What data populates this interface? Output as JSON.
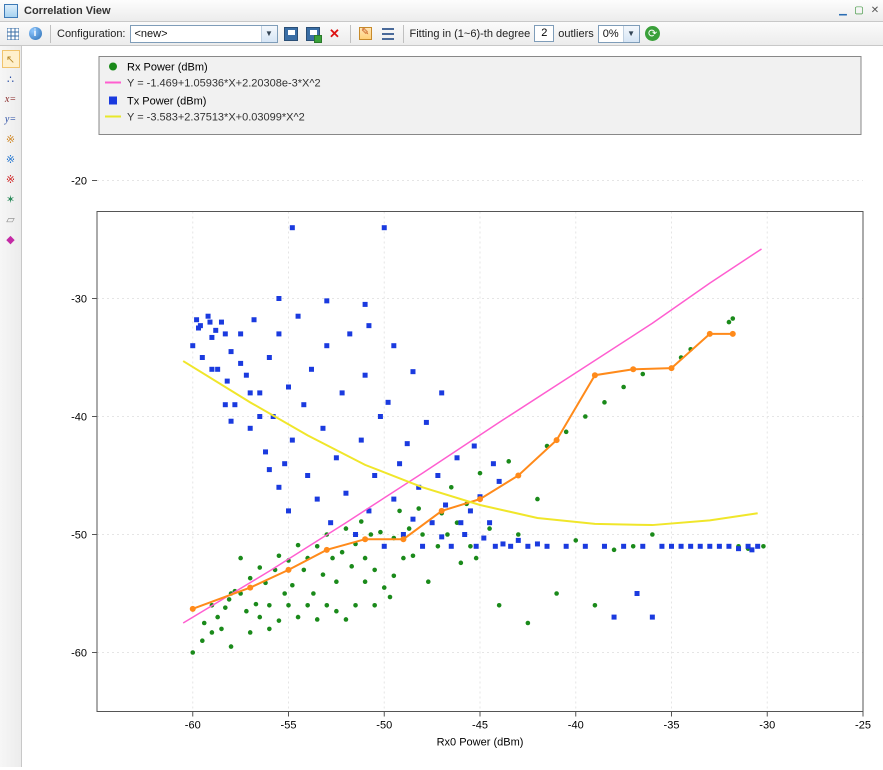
{
  "window": {
    "title": "Correlation View"
  },
  "toolbar": {
    "config_label": "Configuration:",
    "config_value": "<new>",
    "fitting_prefix": "Fitting in (1~6)-th degree",
    "fitting_degree": "2",
    "outliers_label": "outliers",
    "outliers_value": "0%"
  },
  "palette": {
    "items": [
      {
        "name": "select-arrow",
        "glyph": "↖",
        "cls": "arrow-sel",
        "active": true
      },
      {
        "name": "scatter-style",
        "glyph": "∴",
        "cls": "dots"
      },
      {
        "name": "x-equals",
        "glyph": "x=",
        "cls": "xeq"
      },
      {
        "name": "y-equals",
        "glyph": "y=",
        "cls": "yeq"
      },
      {
        "name": "fit-orange",
        "glyph": "※",
        "cls": "burst1"
      },
      {
        "name": "fit-blue",
        "glyph": "※",
        "cls": "burst2"
      },
      {
        "name": "fit-red",
        "glyph": "※",
        "cls": "burst3"
      },
      {
        "name": "centroid",
        "glyph": "✶",
        "cls": "centroid"
      },
      {
        "name": "eraser",
        "glyph": "▱",
        "cls": "eraser"
      },
      {
        "name": "help-book",
        "glyph": "◆",
        "cls": "book"
      }
    ]
  },
  "chart_data": {
    "type": "scatter",
    "xlabel": "Rx0 Power (dBm)",
    "ylabel": "",
    "xlim": [
      -65,
      -25
    ],
    "ylim": [
      -65,
      -15
    ],
    "xticks": [
      -60,
      -55,
      -50,
      -45,
      -40,
      -35,
      -30,
      -25
    ],
    "yticks": [
      -60,
      -50,
      -40,
      -30,
      -20
    ],
    "legend": [
      {
        "marker": "circle",
        "color": "#1a8a1a",
        "label": "Rx Power (dBm)",
        "equation": "Y = -1.469+1.05936*X+2.20308e-3*X^2",
        "eq_color": "#ff5ed0"
      },
      {
        "marker": "square",
        "color": "#1a3adf",
        "label": "Tx Power (dBm)",
        "equation": "Y = -3.583+2.37513*X+0.03099*X^2",
        "eq_color": "#e8e82a"
      }
    ],
    "series": [
      {
        "name": "Rx Power (dBm)",
        "marker": "circle",
        "color": "#1a8a1a",
        "points": [
          [
            -60.0,
            -60.0
          ],
          [
            -59.5,
            -59.0
          ],
          [
            -59.0,
            -58.3
          ],
          [
            -58.7,
            -57.0
          ],
          [
            -58.3,
            -56.2
          ],
          [
            -58.1,
            -55.5
          ],
          [
            -57.8,
            -54.8
          ],
          [
            -57.5,
            -55.0
          ],
          [
            -57.2,
            -56.5
          ],
          [
            -57.0,
            -53.7
          ],
          [
            -56.7,
            -55.9
          ],
          [
            -56.5,
            -52.8
          ],
          [
            -56.2,
            -54.1
          ],
          [
            -56.0,
            -56.0
          ],
          [
            -55.7,
            -53.0
          ],
          [
            -55.5,
            -51.8
          ],
          [
            -55.2,
            -55.0
          ],
          [
            -55.0,
            -52.2
          ],
          [
            -54.8,
            -54.3
          ],
          [
            -54.5,
            -50.9
          ],
          [
            -54.2,
            -53.0
          ],
          [
            -54.0,
            -52.0
          ],
          [
            -53.7,
            -55.0
          ],
          [
            -53.5,
            -51.0
          ],
          [
            -53.2,
            -53.4
          ],
          [
            -53.0,
            -50.0
          ],
          [
            -52.7,
            -52.0
          ],
          [
            -52.5,
            -54.0
          ],
          [
            -52.2,
            -51.5
          ],
          [
            -52.0,
            -49.5
          ],
          [
            -51.7,
            -52.7
          ],
          [
            -51.5,
            -50.8
          ],
          [
            -51.2,
            -48.9
          ],
          [
            -51.0,
            -52.0
          ],
          [
            -50.7,
            -50.0
          ],
          [
            -50.5,
            -53.0
          ],
          [
            -50.2,
            -49.8
          ],
          [
            -50.0,
            -51.0
          ],
          [
            -49.7,
            -55.3
          ],
          [
            -49.5,
            -50.3
          ],
          [
            -49.2,
            -48.0
          ],
          [
            -49.0,
            -52.0
          ],
          [
            -48.7,
            -49.5
          ],
          [
            -48.5,
            -51.8
          ],
          [
            -48.2,
            -47.8
          ],
          [
            -48.0,
            -50.0
          ],
          [
            -47.7,
            -54.0
          ],
          [
            -47.5,
            -49.0
          ],
          [
            -47.2,
            -51.0
          ],
          [
            -47.0,
            -48.2
          ],
          [
            -46.7,
            -50.0
          ],
          [
            -46.5,
            -46.0
          ],
          [
            -46.2,
            -49.0
          ],
          [
            -46.0,
            -52.4
          ],
          [
            -45.7,
            -47.4
          ],
          [
            -45.5,
            -51.0
          ],
          [
            -45.0,
            -44.8
          ],
          [
            -44.5,
            -49.5
          ],
          [
            -44.0,
            -56.0
          ],
          [
            -43.5,
            -43.8
          ],
          [
            -43.0,
            -50.0
          ],
          [
            -42.5,
            -57.5
          ],
          [
            -42.0,
            -47.0
          ],
          [
            -41.5,
            -42.5
          ],
          [
            -41.0,
            -55.0
          ],
          [
            -40.5,
            -41.3
          ],
          [
            -40.0,
            -50.5
          ],
          [
            -39.5,
            -40.0
          ],
          [
            -39.0,
            -56.0
          ],
          [
            -38.5,
            -38.8
          ],
          [
            -38.0,
            -51.3
          ],
          [
            -37.5,
            -37.5
          ],
          [
            -37.0,
            -51.0
          ],
          [
            -36.5,
            -36.4
          ],
          [
            -36.0,
            -50.0
          ],
          [
            -35.0,
            -51.0
          ],
          [
            -34.5,
            -35.0
          ],
          [
            -34.0,
            -34.3
          ],
          [
            -33.0,
            -33.0
          ],
          [
            -32.5,
            -51.0
          ],
          [
            -32.0,
            -32.0
          ],
          [
            -31.8,
            -31.7
          ],
          [
            -31.5,
            -51.0
          ],
          [
            -31.0,
            -51.2
          ],
          [
            -30.5,
            -51.0
          ],
          [
            -30.2,
            -51.0
          ],
          [
            -58.0,
            -59.5
          ],
          [
            -58.5,
            -58.0
          ],
          [
            -57.0,
            -58.3
          ],
          [
            -56.5,
            -57.0
          ],
          [
            -56.0,
            -58.0
          ],
          [
            -55.5,
            -57.3
          ],
          [
            -55.0,
            -56.0
          ],
          [
            -54.5,
            -57.0
          ],
          [
            -54.0,
            -56.0
          ],
          [
            -53.5,
            -57.2
          ],
          [
            -53.0,
            -56.0
          ],
          [
            -52.5,
            -56.5
          ],
          [
            -52.0,
            -57.2
          ],
          [
            -51.5,
            -56.0
          ],
          [
            -51.0,
            -54.0
          ],
          [
            -50.5,
            -56.0
          ],
          [
            -50.0,
            -54.5
          ],
          [
            -49.5,
            -53.5
          ],
          [
            -45.2,
            -52.0
          ],
          [
            -59.0,
            -56.0
          ],
          [
            -58.0,
            -55.0
          ],
          [
            -57.5,
            -52.0
          ],
          [
            -59.4,
            -57.5
          ]
        ]
      },
      {
        "name": "Tx Power (dBm)",
        "marker": "square",
        "color": "#1a3adf",
        "points": [
          [
            -60.0,
            -34.0
          ],
          [
            -59.7,
            -32.5
          ],
          [
            -59.5,
            -35.0
          ],
          [
            -59.2,
            -31.5
          ],
          [
            -59.0,
            -33.3
          ],
          [
            -58.7,
            -36.0
          ],
          [
            -58.5,
            -32.0
          ],
          [
            -58.2,
            -37.0
          ],
          [
            -58.0,
            -34.5
          ],
          [
            -57.8,
            -39.0
          ],
          [
            -57.5,
            -33.0
          ],
          [
            -57.2,
            -36.5
          ],
          [
            -57.0,
            -41.0
          ],
          [
            -56.8,
            -31.8
          ],
          [
            -56.5,
            -38.0
          ],
          [
            -56.2,
            -43.0
          ],
          [
            -56.0,
            -35.0
          ],
          [
            -55.8,
            -40.0
          ],
          [
            -55.5,
            -33.0
          ],
          [
            -55.2,
            -44.0
          ],
          [
            -55.0,
            -37.5
          ],
          [
            -54.8,
            -42.0
          ],
          [
            -54.5,
            -31.5
          ],
          [
            -54.2,
            -39.0
          ],
          [
            -54.0,
            -45.0
          ],
          [
            -53.8,
            -36.0
          ],
          [
            -53.5,
            -47.0
          ],
          [
            -53.2,
            -41.0
          ],
          [
            -53.0,
            -34.0
          ],
          [
            -52.8,
            -49.0
          ],
          [
            -52.5,
            -43.5
          ],
          [
            -52.2,
            -38.0
          ],
          [
            -52.0,
            -46.5
          ],
          [
            -51.8,
            -33.0
          ],
          [
            -51.5,
            -50.0
          ],
          [
            -51.2,
            -42.0
          ],
          [
            -51.0,
            -36.5
          ],
          [
            -50.8,
            -48.0
          ],
          [
            -50.5,
            -45.0
          ],
          [
            -50.2,
            -40.0
          ],
          [
            -50.0,
            -51.0
          ],
          [
            -49.8,
            -38.8
          ],
          [
            -49.5,
            -47.0
          ],
          [
            -49.2,
            -44.0
          ],
          [
            -49.0,
            -50.0
          ],
          [
            -48.8,
            -42.3
          ],
          [
            -48.5,
            -48.7
          ],
          [
            -48.2,
            -46.0
          ],
          [
            -48.0,
            -51.0
          ],
          [
            -47.8,
            -40.5
          ],
          [
            -47.5,
            -49.0
          ],
          [
            -47.2,
            -45.0
          ],
          [
            -47.0,
            -50.2
          ],
          [
            -46.8,
            -47.5
          ],
          [
            -46.5,
            -51.0
          ],
          [
            -46.2,
            -43.5
          ],
          [
            -46.0,
            -49.0
          ],
          [
            -45.8,
            -50.0
          ],
          [
            -45.5,
            -48.0
          ],
          [
            -45.2,
            -51.0
          ],
          [
            -45.0,
            -46.8
          ],
          [
            -44.8,
            -50.3
          ],
          [
            -44.5,
            -49.0
          ],
          [
            -44.2,
            -51.0
          ],
          [
            -54.8,
            -24.0
          ],
          [
            -50.0,
            -24.0
          ],
          [
            -55.5,
            -30.0
          ],
          [
            -53.0,
            -30.2
          ],
          [
            -51.0,
            -30.5
          ],
          [
            -59.8,
            -31.8
          ],
          [
            -59.6,
            -32.3
          ],
          [
            -59.1,
            -32.0
          ],
          [
            -58.8,
            -32.7
          ],
          [
            -58.3,
            -33.0
          ],
          [
            -40.5,
            -51.0
          ],
          [
            -39.5,
            -51.0
          ],
          [
            -38.5,
            -51.0
          ],
          [
            -38.0,
            -57.0
          ],
          [
            -37.5,
            -51.0
          ],
          [
            -36.8,
            -55.0
          ],
          [
            -36.5,
            -51.0
          ],
          [
            -36.0,
            -57.0
          ],
          [
            -35.5,
            -51.0
          ],
          [
            -35.0,
            -51.0
          ],
          [
            -34.5,
            -51.0
          ],
          [
            -34.0,
            -51.0
          ],
          [
            -33.5,
            -51.0
          ],
          [
            -33.0,
            -51.0
          ],
          [
            -32.5,
            -51.0
          ],
          [
            -32.0,
            -51.0
          ],
          [
            -31.5,
            -51.2
          ],
          [
            -31.0,
            -51.0
          ],
          [
            -30.8,
            -51.3
          ],
          [
            -30.5,
            -51.0
          ],
          [
            -43.8,
            -50.8
          ],
          [
            -43.4,
            -51.0
          ],
          [
            -43.0,
            -50.5
          ],
          [
            -42.5,
            -51.0
          ],
          [
            -42.0,
            -50.8
          ],
          [
            -41.5,
            -51.0
          ],
          [
            -55.0,
            -48.0
          ],
          [
            -55.5,
            -46.0
          ],
          [
            -56.0,
            -44.5
          ],
          [
            -56.5,
            -40.0
          ],
          [
            -57.0,
            -38.0
          ],
          [
            -57.5,
            -35.5
          ],
          [
            -58.0,
            -40.4
          ],
          [
            -58.3,
            -39.0
          ],
          [
            -59.0,
            -36.0
          ],
          [
            -44.0,
            -45.5
          ],
          [
            -44.3,
            -44.0
          ],
          [
            -45.3,
            -42.5
          ],
          [
            -47.0,
            -38.0
          ],
          [
            -48.5,
            -36.2
          ],
          [
            -49.5,
            -34.0
          ],
          [
            -50.8,
            -32.3
          ]
        ]
      }
    ],
    "fits": [
      {
        "name": "Rx fit (pink)",
        "color": "#ff5ed0",
        "width": 1.5,
        "points": [
          [
            -60.5,
            -57.5
          ],
          [
            -56,
            -53.1
          ],
          [
            -52,
            -49.0
          ],
          [
            -48,
            -44.8
          ],
          [
            -44,
            -40.5
          ],
          [
            -40,
            -36.3
          ],
          [
            -36,
            -32.1
          ],
          [
            -33,
            -28.7
          ],
          [
            -30.3,
            -25.8
          ]
        ]
      },
      {
        "name": "Rx mean (orange)",
        "color": "#ff8a1a",
        "width": 2,
        "points": [
          [
            -60,
            -56.3
          ],
          [
            -57,
            -54.5
          ],
          [
            -55,
            -53.0
          ],
          [
            -53,
            -51.3
          ],
          [
            -51,
            -50.4
          ],
          [
            -49,
            -50.4
          ],
          [
            -47,
            -48.0
          ],
          [
            -45,
            -47.0
          ],
          [
            -43,
            -45.0
          ],
          [
            -41,
            -42.0
          ],
          [
            -39,
            -36.5
          ],
          [
            -37,
            -36.0
          ],
          [
            -35,
            -35.9
          ],
          [
            -33,
            -33.0
          ],
          [
            -31.8,
            -33.0
          ]
        ]
      },
      {
        "name": "Tx fit (yellow)",
        "color": "#f0e62a",
        "width": 2,
        "points": [
          [
            -60.5,
            -35.3
          ],
          [
            -57,
            -38.8
          ],
          [
            -54,
            -41.6
          ],
          [
            -51,
            -44.1
          ],
          [
            -48,
            -46.0
          ],
          [
            -45,
            -47.5
          ],
          [
            -42,
            -48.6
          ],
          [
            -39,
            -49.1
          ],
          [
            -36,
            -49.2
          ],
          [
            -33,
            -48.8
          ],
          [
            -30.5,
            -48.2
          ]
        ]
      }
    ]
  }
}
